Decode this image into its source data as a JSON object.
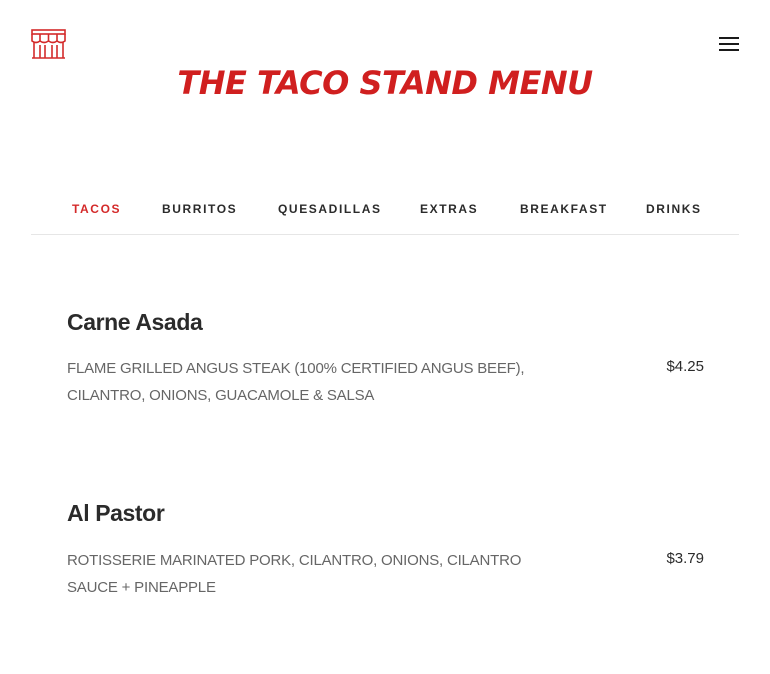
{
  "header": {
    "title": "The Taco Stand Menu",
    "logo_icon": "storefront-icon",
    "menu_icon": "hamburger-menu-icon",
    "accent_color": "#d42a2a"
  },
  "tabs": [
    {
      "label": "Tacos",
      "active": true
    },
    {
      "label": "Burritos",
      "active": false
    },
    {
      "label": "Quesadillas",
      "active": false
    },
    {
      "label": "Extras",
      "active": false
    },
    {
      "label": "Breakfast",
      "active": false
    },
    {
      "label": "Drinks",
      "active": false
    }
  ],
  "items": [
    {
      "name": "Carne Asada",
      "description": "Flame grilled angus steak (100% certified angus beef), cilantro, onions, guacamole & salsa",
      "price": "$4.25"
    },
    {
      "name": "Al Pastor",
      "description": "Rotisserie marinated pork, cilantro, onions, cilantro sauce + pineapple",
      "price": "$3.79"
    }
  ]
}
